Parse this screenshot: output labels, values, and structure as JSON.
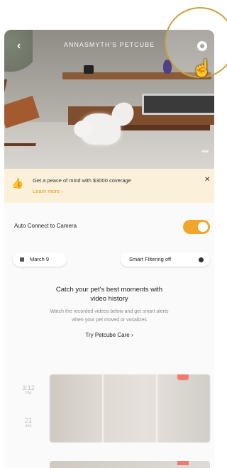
{
  "header": {
    "title": "ANNASMYTH'S PETCUBE"
  },
  "banner": {
    "text": "Get a peace of mind with $3000 coverage",
    "link": "Learn more"
  },
  "auto_connect": {
    "label": "Auto Connect to Camera",
    "enabled": true
  },
  "filters": {
    "date": "March 9",
    "smart": "Smart Filtering off"
  },
  "catch": {
    "title": "Catch your pet's best moments with video history",
    "description": "Watch the recorded videos below and get smart alerts when your pet moved or vocalizes",
    "link": "Try Petcube Care"
  },
  "history": [
    {
      "time": "3:12",
      "period": "PM"
    },
    {
      "time": "21",
      "period": "sec"
    }
  ],
  "colors": {
    "accent": "#f2a52b",
    "banner_bg": "#fbf0d9"
  }
}
